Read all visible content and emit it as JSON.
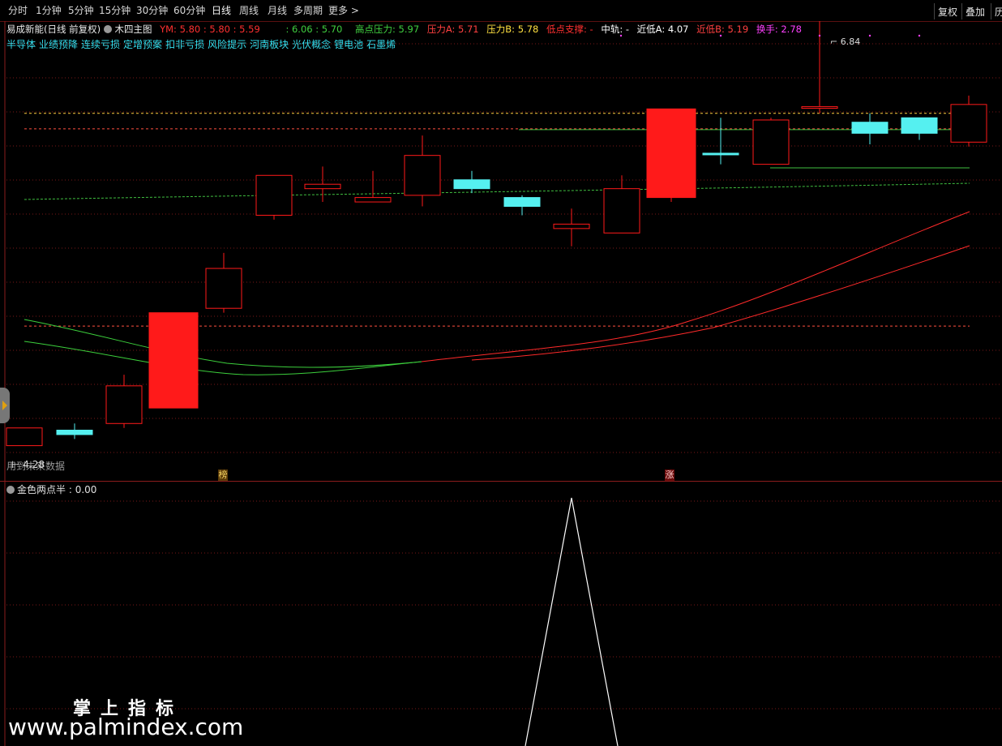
{
  "periods": {
    "items": [
      "分时",
      "1分钟",
      "5分钟",
      "15分钟",
      "30分钟",
      "60分钟",
      "日线",
      "周线",
      "月线",
      "多周期",
      "更多 >"
    ],
    "active": "日线"
  },
  "right_buttons": [
    "复权",
    "叠加",
    "历"
  ],
  "info": {
    "stock": "易成新能(日线 前复权)",
    "template": "木四主图",
    "ym_label": "YM:",
    "ym_values": "5.80 : 5.80 : 5.59",
    "green_values": ": 6.06 : 5.70",
    "high_pressure": "高点压力: 5.97",
    "pressure_a": "压力A: 5.71",
    "pressure_b": "压力B: 5.78",
    "low_support": "低点支撑: -",
    "mid": "中轨: -",
    "near_low_a": "近低A: 4.07",
    "near_low_b": "近低B: 5.19",
    "turnover": "换手: 2.78"
  },
  "concepts": [
    "半导体",
    "业绩预降",
    "连续亏损",
    "定增预案",
    "扣非亏损",
    "风险提示",
    "河南板块",
    "光伏概念",
    "锂电池",
    "石墨烯"
  ],
  "annotations": {
    "high": "6.84",
    "low": "4.28",
    "note": "用到未来数据",
    "marker_a": "榜",
    "marker_b": "涨"
  },
  "indicator": {
    "name": "金色两点半",
    "value": ": 0.00"
  },
  "watermark": {
    "line1": "掌上指标",
    "line2": "www.palmindex.com"
  },
  "colors": {
    "up": "#ff1a1a",
    "down": "#55f0f0",
    "ma_red": "#ff2a2a",
    "ma_green": "#3ccf3c",
    "grid": "#7a1818"
  },
  "chart_data": {
    "type": "candlestick",
    "candles": [
      {
        "o": 4.28,
        "h": 4.36,
        "l": 4.28,
        "c": 4.36,
        "up": true
      },
      {
        "o": 4.33,
        "h": 4.38,
        "l": 4.31,
        "c": 4.35,
        "up": false
      },
      {
        "o": 4.38,
        "h": 4.6,
        "l": 4.36,
        "c": 4.55,
        "up": true
      },
      {
        "o": 4.45,
        "h": 4.88,
        "l": 4.45,
        "c": 4.88,
        "up": true,
        "solid": true
      },
      {
        "o": 4.9,
        "h": 5.15,
        "l": 4.88,
        "c": 5.08,
        "up": true
      },
      {
        "o": 5.32,
        "h": 5.39,
        "l": 5.3,
        "c": 5.5,
        "up": true
      },
      {
        "o": 5.46,
        "h": 5.54,
        "l": 5.38,
        "c": 5.44,
        "up": true
      },
      {
        "o": 5.4,
        "h": 5.52,
        "l": 5.38,
        "c": 5.38,
        "up": true
      },
      {
        "o": 5.41,
        "h": 5.68,
        "l": 5.36,
        "c": 5.59,
        "up": true
      },
      {
        "o": 5.48,
        "h": 5.52,
        "l": 5.42,
        "c": 5.44,
        "up": false
      },
      {
        "o": 5.4,
        "h": 5.41,
        "l": 5.32,
        "c": 5.36,
        "up": false
      },
      {
        "o": 5.26,
        "h": 5.35,
        "l": 5.18,
        "c": 5.28,
        "up": true
      },
      {
        "o": 5.24,
        "h": 5.5,
        "l": 5.24,
        "c": 5.44,
        "up": true
      },
      {
        "o": 5.4,
        "h": 5.8,
        "l": 5.38,
        "c": 5.8,
        "up": true,
        "solid": true
      },
      {
        "o": 5.6,
        "h": 5.76,
        "l": 5.55,
        "c": 5.6,
        "up": false
      },
      {
        "o": 5.75,
        "h": 5.76,
        "l": 5.55,
        "c": 5.55,
        "up": true
      },
      {
        "o": 5.81,
        "h": 6.84,
        "l": 5.78,
        "c": 5.81,
        "up": true
      },
      {
        "o": 5.74,
        "h": 5.78,
        "l": 5.64,
        "c": 5.69,
        "up": false
      },
      {
        "o": 5.76,
        "h": 5.76,
        "l": 5.66,
        "c": 5.69,
        "up": false
      },
      {
        "o": 5.82,
        "h": 5.86,
        "l": 5.63,
        "c": 5.65,
        "up": true
      }
    ],
    "ylim": [
      4.22,
      6.05
    ],
    "levels": {
      "high_pressure": 5.97,
      "pressure_a": 5.71,
      "pressure_b": 5.78,
      "near_low_a": 4.07,
      "near_low_b": 5.19
    },
    "indicator_series": [
      0,
      0,
      0,
      0,
      0,
      0,
      0,
      0,
      0,
      0,
      0,
      0,
      0,
      0,
      0,
      0,
      0,
      0,
      0,
      0
    ],
    "indicator_peak_index": 11
  }
}
